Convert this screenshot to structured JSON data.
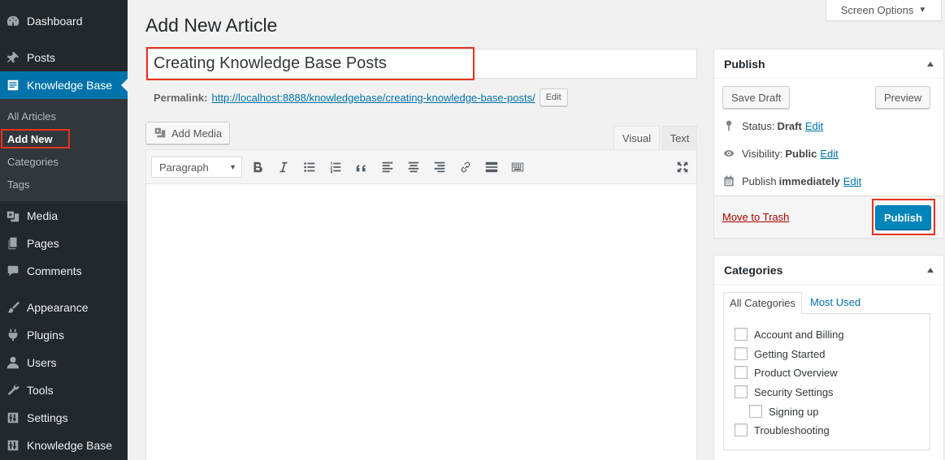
{
  "sidebar": {
    "items": [
      {
        "label": "Dashboard",
        "icon": "dashboard-icon"
      },
      {
        "label": "Posts",
        "icon": "pin-icon"
      },
      {
        "label": "Knowledge Base",
        "icon": "document-icon"
      },
      {
        "label": "Media",
        "icon": "media-icon"
      },
      {
        "label": "Pages",
        "icon": "pages-icon"
      },
      {
        "label": "Comments",
        "icon": "comment-icon"
      },
      {
        "label": "Appearance",
        "icon": "brush-icon"
      },
      {
        "label": "Plugins",
        "icon": "plugin-icon"
      },
      {
        "label": "Users",
        "icon": "user-icon"
      },
      {
        "label": "Tools",
        "icon": "wrench-icon"
      },
      {
        "label": "Settings",
        "icon": "settings-icon"
      },
      {
        "label": "Knowledge Base",
        "icon": "settings-icon"
      }
    ],
    "submenu": [
      {
        "label": "All Articles"
      },
      {
        "label": "Add New"
      },
      {
        "label": "Categories"
      },
      {
        "label": "Tags"
      }
    ]
  },
  "header": {
    "title": "Add New Article",
    "screen_options": "Screen Options"
  },
  "post": {
    "title_value": "Creating Knowledge Base Posts",
    "permalink_label": "Permalink:",
    "permalink_url": "http://localhost:8888/knowledgebase/creating-knowledge-base-posts/",
    "permalink_edit": "Edit"
  },
  "editor": {
    "add_media": "Add Media",
    "tab_visual": "Visual",
    "tab_text": "Text",
    "format_select": "Paragraph"
  },
  "publish": {
    "title": "Publish",
    "save_draft": "Save Draft",
    "preview": "Preview",
    "status_label": "Status:",
    "status_value": "Draft",
    "visibility_label": "Visibility:",
    "visibility_value": "Public",
    "publish_label": "Publish",
    "publish_value": "immediately",
    "edit": "Edit",
    "move_to_trash": "Move to Trash",
    "publish_button": "Publish"
  },
  "categories": {
    "title": "Categories",
    "tab_all": "All Categories",
    "tab_most_used": "Most Used",
    "items": [
      {
        "label": "Account and Billing"
      },
      {
        "label": "Getting Started"
      },
      {
        "label": "Product Overview"
      },
      {
        "label": "Security Settings"
      },
      {
        "label": "Signing up"
      },
      {
        "label": "Troubleshooting"
      }
    ]
  },
  "colors": {
    "accent": "#0073aa",
    "highlight": "#e8321e",
    "sidebar_bg": "#23282d"
  }
}
